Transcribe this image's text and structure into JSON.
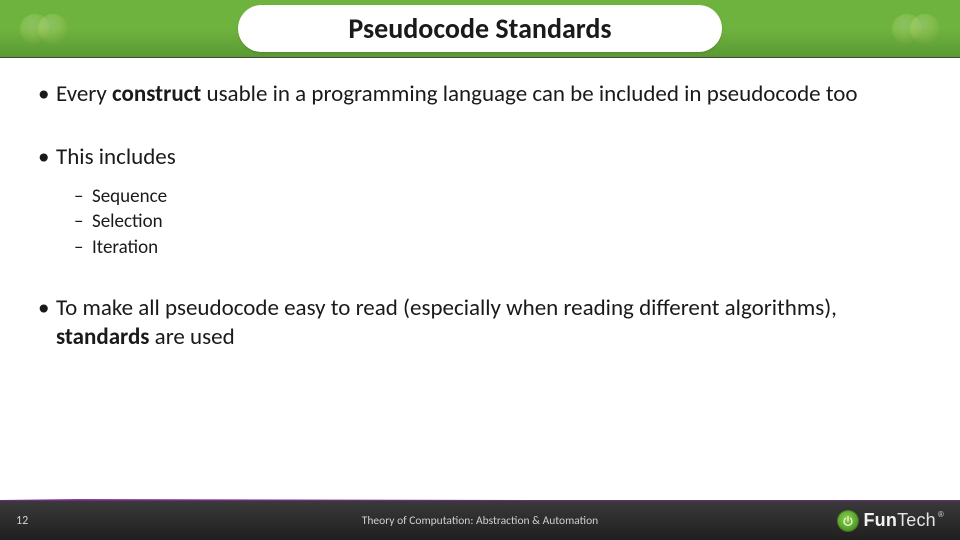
{
  "title": "Pseudocode Standards",
  "bullets": {
    "b1_prefix": "Every ",
    "b1_bold": "construct",
    "b1_suffix": " usable in a programming language can be included in pseudocode too",
    "b2": "This includes",
    "sub1": "Sequence",
    "sub2": "Selection",
    "sub3": "Iteration",
    "b3_prefix": "To make all pseudocode easy to read (especially when reading different algorithms), ",
    "b3_bold": "standards",
    "b3_suffix": " are used"
  },
  "footer": {
    "page": "12",
    "text": "Theory of Computation: Abstraction & Automation",
    "brand_a": "Fun",
    "brand_b": "Tech",
    "reg": "®"
  }
}
